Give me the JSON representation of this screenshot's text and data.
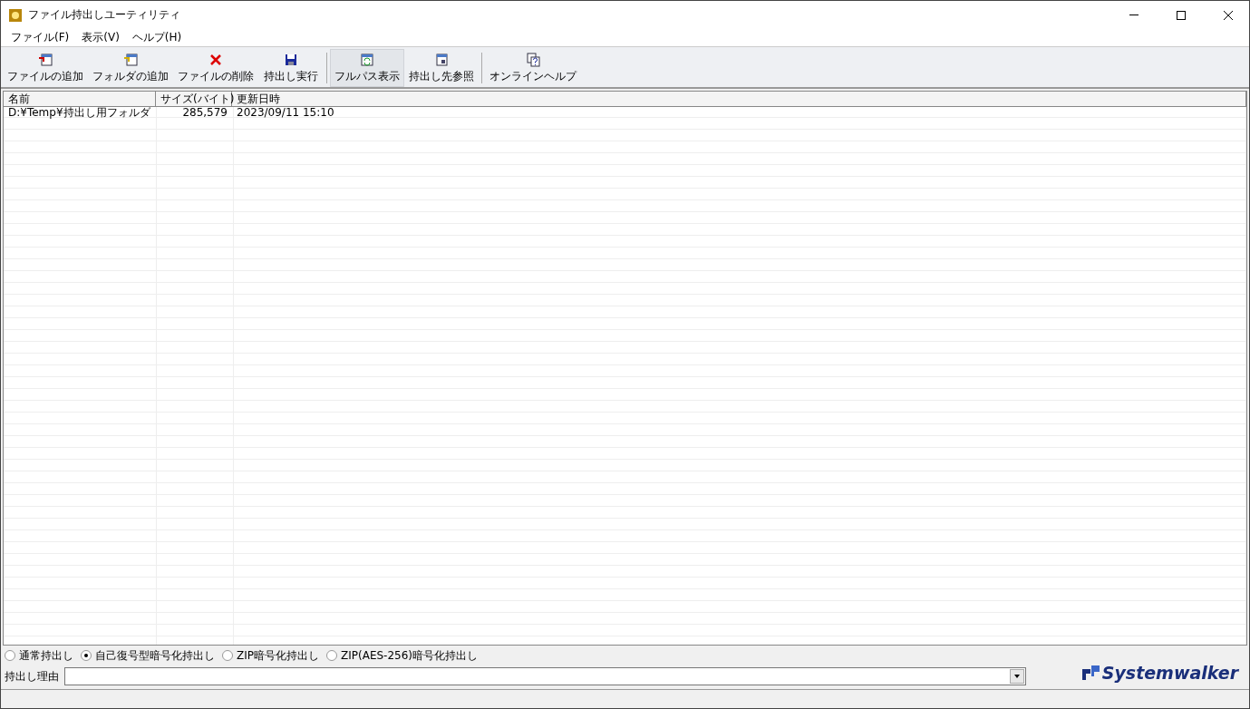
{
  "window": {
    "title": "ファイル持出しユーティリティ"
  },
  "menu": [
    "ファイル(F)",
    "表示(V)",
    "ヘルプ(H)"
  ],
  "toolbar": [
    {
      "kind": "add-file",
      "label": "ファイルの追加",
      "pressed": false
    },
    {
      "kind": "add-folder",
      "label": "フォルダの追加",
      "pressed": false
    },
    {
      "kind": "delete",
      "label": "ファイルの削除",
      "pressed": false
    },
    {
      "kind": "save",
      "label": "持出し実行",
      "pressed": false
    },
    {
      "kind": "separator"
    },
    {
      "kind": "fullpath",
      "label": "フルパス表示",
      "pressed": true
    },
    {
      "kind": "browse",
      "label": "持出し先参照",
      "pressed": false
    },
    {
      "kind": "separator"
    },
    {
      "kind": "help",
      "label": "オンラインヘルプ",
      "pressed": false
    }
  ],
  "table": {
    "columns": [
      "名前",
      "サイズ(バイト)",
      "更新日時"
    ],
    "rows": [
      [
        "D:¥Temp¥持出し用フォルダ",
        "285,579",
        "2023/09/11 15:10"
      ]
    ]
  },
  "modes": [
    {
      "label": "通常持出し",
      "selected": false
    },
    {
      "label": "自己復号型暗号化持出し",
      "selected": true
    },
    {
      "label": "ZIP暗号化持出し",
      "selected": false
    },
    {
      "label": "ZIP(AES-256)暗号化持出し",
      "selected": false
    }
  ],
  "reason": {
    "label": "持出し理由"
  },
  "logo": {
    "text": "Systemwalker"
  }
}
